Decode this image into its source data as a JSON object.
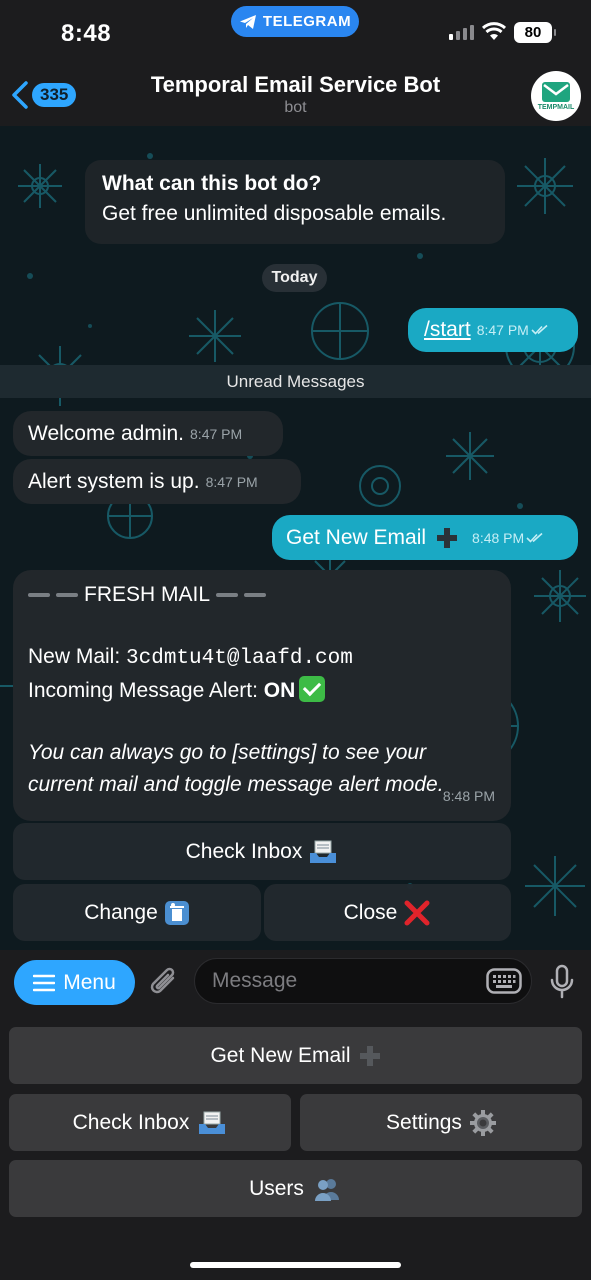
{
  "status_bar": {
    "time": "8:48",
    "app_pill": "TELEGRAM",
    "battery": "80"
  },
  "header": {
    "back_count": "335",
    "title": "Temporal Email Service Bot",
    "subtitle": "bot",
    "avatar_text": "TEMPMAIL"
  },
  "bot_info": {
    "title": "What can this bot do?",
    "text": "Get free unlimited disposable emails."
  },
  "day_separator": "Today",
  "unread_separator": "Unread Messages",
  "messages": [
    {
      "text": "/start",
      "time": "8:47 PM",
      "outgoing": true
    },
    {
      "text": "Welcome admin.",
      "time": "8:47 PM",
      "outgoing": false
    },
    {
      "text": "Alert system is up.",
      "time": "8:47 PM",
      "outgoing": false
    },
    {
      "text": "Get New Email",
      "time": "8:48 PM",
      "outgoing": true
    }
  ],
  "fresh_mail": {
    "heading": "FRESH MAIL",
    "new_mail_label": "New Mail: ",
    "new_mail_value": "3cdmtu4t@laafd.com",
    "alert_label": "Incoming Message Alert: ",
    "alert_value": "ON",
    "note": "You can always go to [settings] to see your current mail and toggle message alert mode.",
    "time": "8:48 PM"
  },
  "inline_buttons": {
    "check_inbox": "Check Inbox",
    "change": "Change",
    "close": "Close"
  },
  "composer": {
    "menu": "Menu",
    "placeholder": "Message"
  },
  "reply_keyboard": {
    "get_new_email": "Get New Email",
    "check_inbox": "Check Inbox",
    "settings": "Settings",
    "users": "Users"
  },
  "colors": {
    "accent": "#2ea6ff",
    "outgoing_bubble": "#1aa9c4",
    "incoming_bubble": "#22272b",
    "check_green": "#3dbb46",
    "close_red": "#e0242b"
  }
}
